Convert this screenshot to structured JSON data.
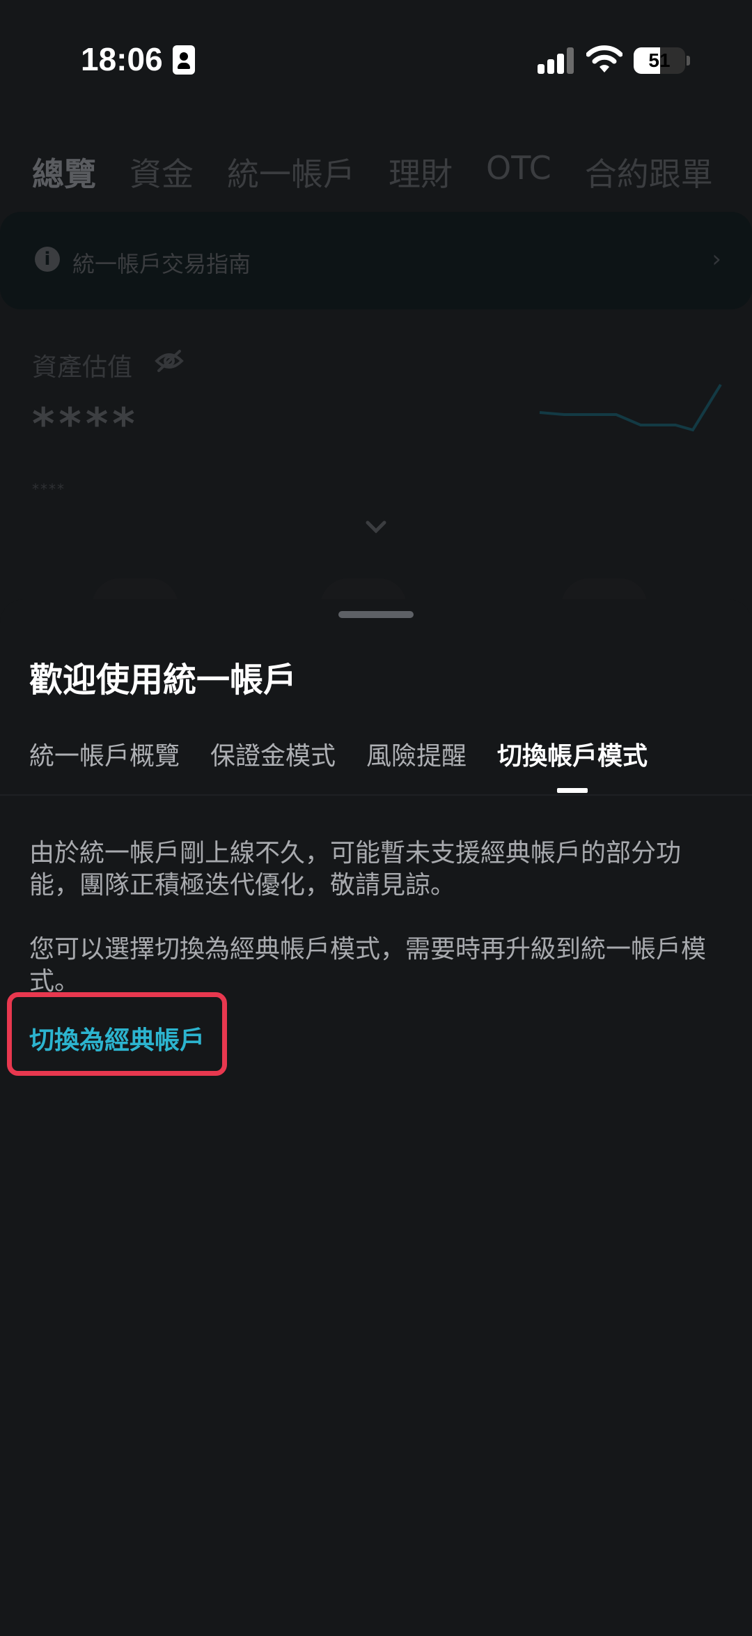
{
  "status_bar": {
    "time": "18:06",
    "battery": "51"
  },
  "background": {
    "tabs": [
      "總覽",
      "資金",
      "統一帳戶",
      "理財",
      "OTC",
      "合約跟單"
    ],
    "guide_text": "統一帳戶交易指南",
    "asset_label": "資產估值",
    "asset_value": "****",
    "asset_sub": "****"
  },
  "sheet": {
    "title": "歡迎使用統一帳戶",
    "tabs": [
      "統一帳戶概覽",
      "保證金模式",
      "風險提醒",
      "切換帳戶模式"
    ],
    "active_tab": "切換帳戶模式",
    "paragraph_1": "由於統一帳戶剛上線不久，可能暫未支援經典帳戶的部分功能，團隊正積極迭代優化，敬請見諒。",
    "paragraph_2": "您可以選擇切換為經典帳戶模式，需要時再升級到統一帳戶模式。",
    "switch_link": "切換為經典帳戶"
  },
  "colors": {
    "accent": "#2cb4cf",
    "highlight": "#e8384f",
    "sheet_bg": "#151719"
  }
}
